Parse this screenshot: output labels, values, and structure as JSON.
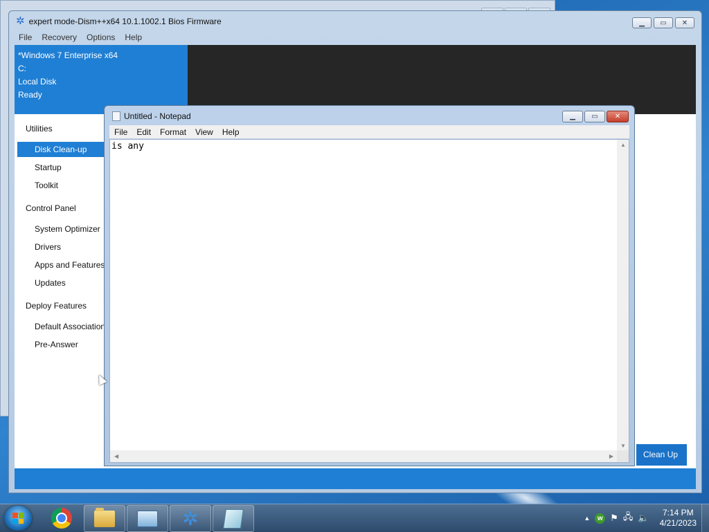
{
  "dism": {
    "title": "expert mode-Dism++x64 10.1.1002.1 Bios Firmware",
    "menu": [
      "File",
      "Recovery",
      "Options",
      "Help"
    ],
    "info": {
      "os": "*Windows 7 Enterprise x64",
      "drive": "C:",
      "disk": "Local Disk",
      "status": "Ready"
    },
    "nav": {
      "utilities_header": "Utilities",
      "disk_cleanup": "Disk Clean-up",
      "startup": "Startup",
      "toolkit": "Toolkit",
      "control_panel_header": "Control Panel",
      "system_optimizer": "System Optimizer",
      "drivers": "Drivers",
      "apps_features": "Apps and Features",
      "updates": "Updates",
      "deploy_header": "Deploy Features",
      "default_assoc": "Default Associations",
      "pre_answer": "Pre-Answer"
    },
    "cleanup_button": "Clean Up",
    "accent_color": "#1f7fd4"
  },
  "notepad": {
    "title": "Untitled - Notepad",
    "menu": [
      "File",
      "Edit",
      "Format",
      "View",
      "Help"
    ],
    "text": "is any"
  },
  "taskbar": {
    "apps": [
      "chrome-icon",
      "explorer-folder-icon",
      "control-panel-icon",
      "dism-gear-icon",
      "notepad-icon"
    ],
    "time": "7:14 PM",
    "date": "4/21/2023"
  }
}
